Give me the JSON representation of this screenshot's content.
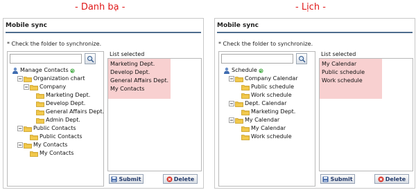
{
  "captions": {
    "left": "- Danh bạ -",
    "right": "- Lịch -"
  },
  "panels": {
    "left": {
      "title": "Mobile sync",
      "instruction": "* Check the folder to synchronize.",
      "search": {
        "value": "",
        "placeholder": ""
      },
      "list_label": "List selected",
      "submit_label": "Submit",
      "delete_label": "Delete",
      "tree": {
        "root": "Manage Contacts",
        "org_chart": "Organization chart",
        "company": "Company",
        "company_children": [
          "Marketing Dept.",
          "Develop Dept.",
          "General Affairs Dept.",
          "Admin Dept."
        ],
        "public_contacts": "Public Contacts",
        "public_contacts_child": "Public Contacts",
        "my_contacts": "My Contacts",
        "my_contacts_child": "My Contacts"
      },
      "selected": [
        "Marketing Dept.",
        "Develop Dept.",
        "General Affairs Dept.",
        "My Contacts"
      ]
    },
    "right": {
      "title": "Mobile sync",
      "instruction": "* Check the folder to synchronize.",
      "search": {
        "value": "",
        "placeholder": ""
      },
      "list_label": "List selected",
      "submit_label": "Submit",
      "delete_label": "Delete",
      "tree": {
        "root": "Schedule",
        "company_calendar": "Company Calendar",
        "company_calendar_children": [
          "Public schedule",
          "Work schedule"
        ],
        "dept_calendar": "Dept. Calendar",
        "dept_calendar_child": "Marketing Dept.",
        "my_calendar": "My Calendar",
        "my_calendar_children": [
          "My Calendar",
          "Work schedule"
        ]
      },
      "selected": [
        "My Calendar",
        "Public schedule",
        "Work schedule"
      ]
    }
  },
  "colors": {
    "caption": "#e0191a",
    "highlight": "#f8d0d0",
    "rule": "#4d6c8e",
    "folder": "#f2c94c"
  }
}
